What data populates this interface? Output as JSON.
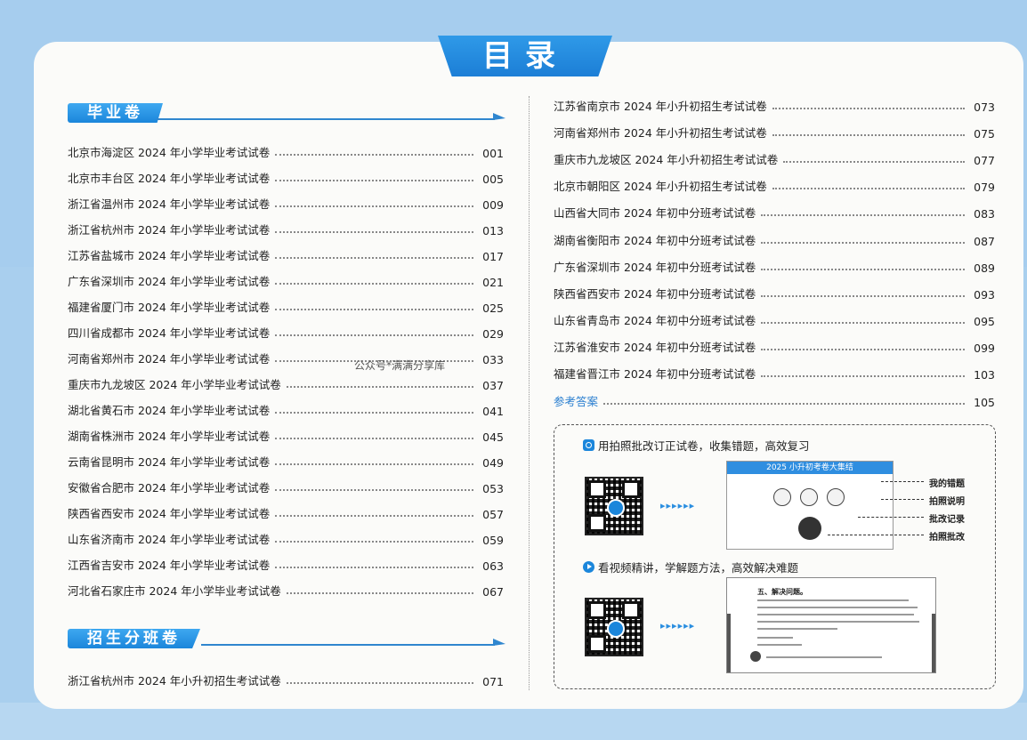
{
  "title": "目录",
  "watermark": "公众号*满满分享库",
  "sections": [
    {
      "label": "毕业卷"
    },
    {
      "label": "招生分班卷"
    }
  ],
  "left_items": [
    {
      "title": "北京市海淀区 2024 年小学毕业考试试卷",
      "page": "001"
    },
    {
      "title": "北京市丰台区 2024 年小学毕业考试试卷",
      "page": "005"
    },
    {
      "title": "浙江省温州市 2024 年小学毕业考试试卷",
      "page": "009"
    },
    {
      "title": "浙江省杭州市 2024 年小学毕业考试试卷",
      "page": "013"
    },
    {
      "title": "江苏省盐城市 2024 年小学毕业考试试卷",
      "page": "017"
    },
    {
      "title": "广东省深圳市 2024 年小学毕业考试试卷",
      "page": "021"
    },
    {
      "title": "福建省厦门市 2024 年小学毕业考试试卷",
      "page": "025"
    },
    {
      "title": "四川省成都市 2024 年小学毕业考试试卷",
      "page": "029"
    },
    {
      "title": "河南省郑州市 2024 年小学毕业考试试卷",
      "page": "033"
    },
    {
      "title": "重庆市九龙坡区 2024 年小学毕业考试试卷",
      "page": "037"
    },
    {
      "title": "湖北省黄石市 2024 年小学毕业考试试卷",
      "page": "041"
    },
    {
      "title": "湖南省株洲市 2024 年小学毕业考试试卷",
      "page": "045"
    },
    {
      "title": "云南省昆明市 2024 年小学毕业考试试卷",
      "page": "049"
    },
    {
      "title": "安徽省合肥市 2024 年小学毕业考试试卷",
      "page": "053"
    },
    {
      "title": "陕西省西安市 2024 年小学毕业考试试卷",
      "page": "057"
    },
    {
      "title": "山东省济南市 2024 年小学毕业考试试卷",
      "page": "059"
    },
    {
      "title": "江西省吉安市 2024 年小学毕业考试试卷",
      "page": "063"
    },
    {
      "title": "河北省石家庄市 2024 年小学毕业考试试卷",
      "page": "067"
    }
  ],
  "left_items_2": [
    {
      "title": "浙江省杭州市 2024 年小升初招生考试试卷",
      "page": "071"
    }
  ],
  "right_items": [
    {
      "title": "江苏省南京市 2024 年小升初招生考试试卷",
      "page": "073"
    },
    {
      "title": "河南省郑州市 2024 年小升初招生考试试卷",
      "page": "075"
    },
    {
      "title": "重庆市九龙坡区 2024 年小升初招生考试试卷",
      "page": "077"
    },
    {
      "title": "北京市朝阳区 2024 年小升初招生考试试卷",
      "page": "079"
    },
    {
      "title": "山西省大同市 2024 年初中分班考试试卷",
      "page": "083"
    },
    {
      "title": "湖南省衡阳市 2024 年初中分班考试试卷",
      "page": "087"
    },
    {
      "title": "广东省深圳市 2024 年初中分班考试试卷",
      "page": "089"
    },
    {
      "title": "陕西省西安市 2024 年初中分班考试试卷",
      "page": "093"
    },
    {
      "title": "山东省青岛市 2024 年初中分班考试试卷",
      "page": "095"
    },
    {
      "title": "江苏省淮安市 2024 年初中分班考试试卷",
      "page": "099"
    },
    {
      "title": "福建省晋江市 2024 年初中分班考试试卷",
      "page": "103"
    }
  ],
  "answers": {
    "title": "参考答案",
    "page": "105"
  },
  "features": {
    "photo": {
      "title": "用拍照批改订正试卷，收集错题，高效复习",
      "screen_title": "2025 小升初考卷大集结",
      "callouts": [
        "我的错题",
        "拍照说明",
        "批改记录",
        "拍照批改"
      ]
    },
    "video": {
      "title": "看视频精讲，学解题方法，高效解决难题",
      "screen_heading": "五、解决问题。"
    }
  },
  "colors": {
    "accent": "#1b86db",
    "answer_link": "#2a7fd0"
  }
}
